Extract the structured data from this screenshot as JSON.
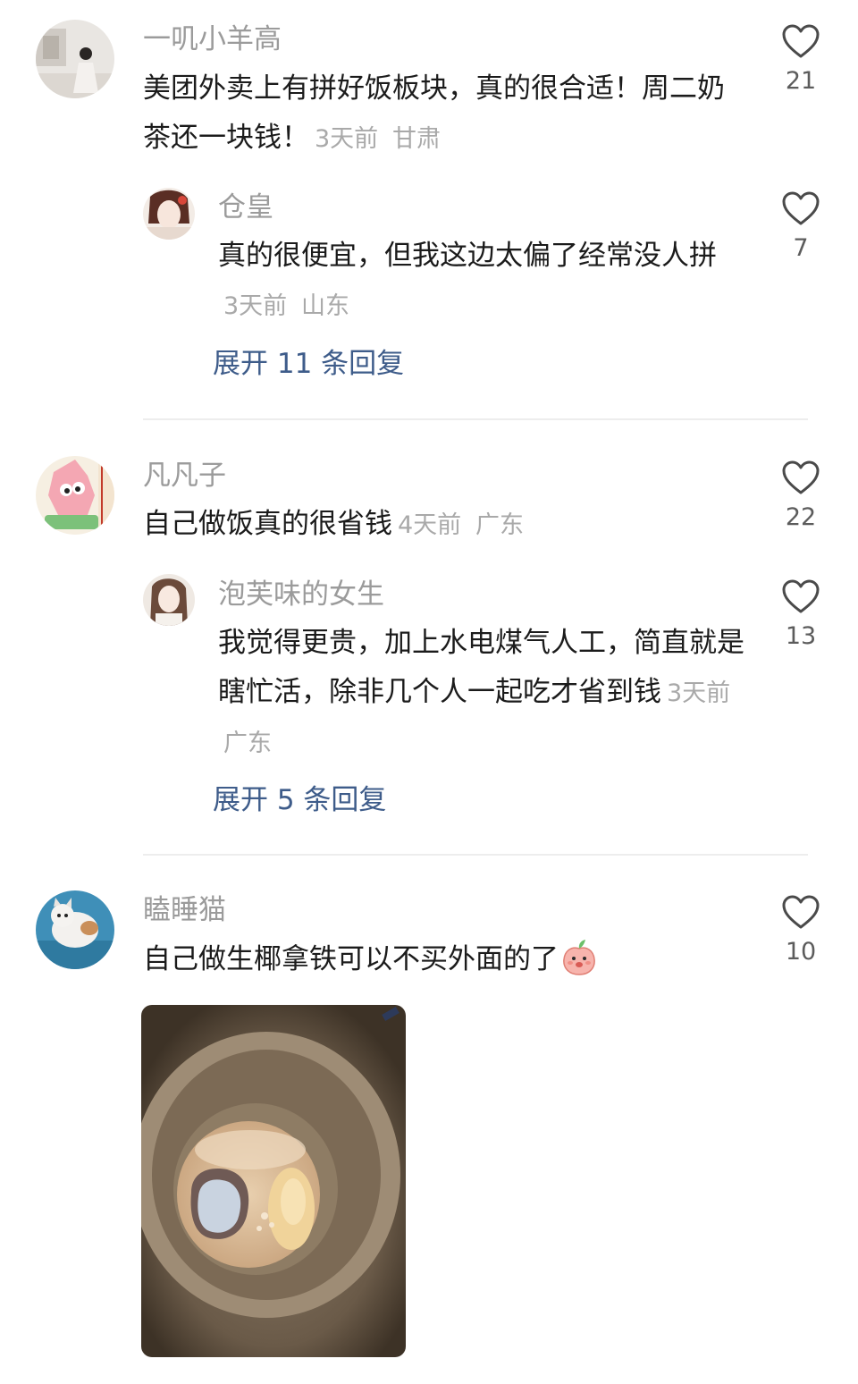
{
  "comments": [
    {
      "username": "一叽小羊高",
      "text": "美团外卖上有拼好饭板块，真的很合适！周二奶茶还一块钱！",
      "time": "3天前",
      "location": "甘肃",
      "likes": "21",
      "reply": {
        "username": "仓皇",
        "text": "真的很便宜，但我这边太偏了经常没人拼",
        "time": "3天前",
        "location": "山东",
        "likes": "7"
      },
      "expand_label": "展开 11 条回复"
    },
    {
      "username": "凡凡子",
      "text": "自己做饭真的很省钱",
      "time": "4天前",
      "location": "广东",
      "likes": "22",
      "reply": {
        "username": "泡芙味的女生",
        "text": "我觉得更贵，加上水电煤气人工，简直就是瞎忙活，除非几个人一起吃才省到钱",
        "time": "3天前",
        "location": "广东",
        "likes": "13"
      },
      "expand_label": "展开 5 条回复"
    },
    {
      "username": "瞌睡猫",
      "text": "自己做生椰拿铁可以不买外面的了",
      "emoji": "peach-face-emoji",
      "likes": "10",
      "image": "coconut-latte-photo"
    }
  ],
  "colors": {
    "username": "#9b9b9b",
    "text": "#1b1b1b",
    "meta": "#a9a9a9",
    "expand": "#3e5c8a",
    "divider": "#ededed"
  }
}
